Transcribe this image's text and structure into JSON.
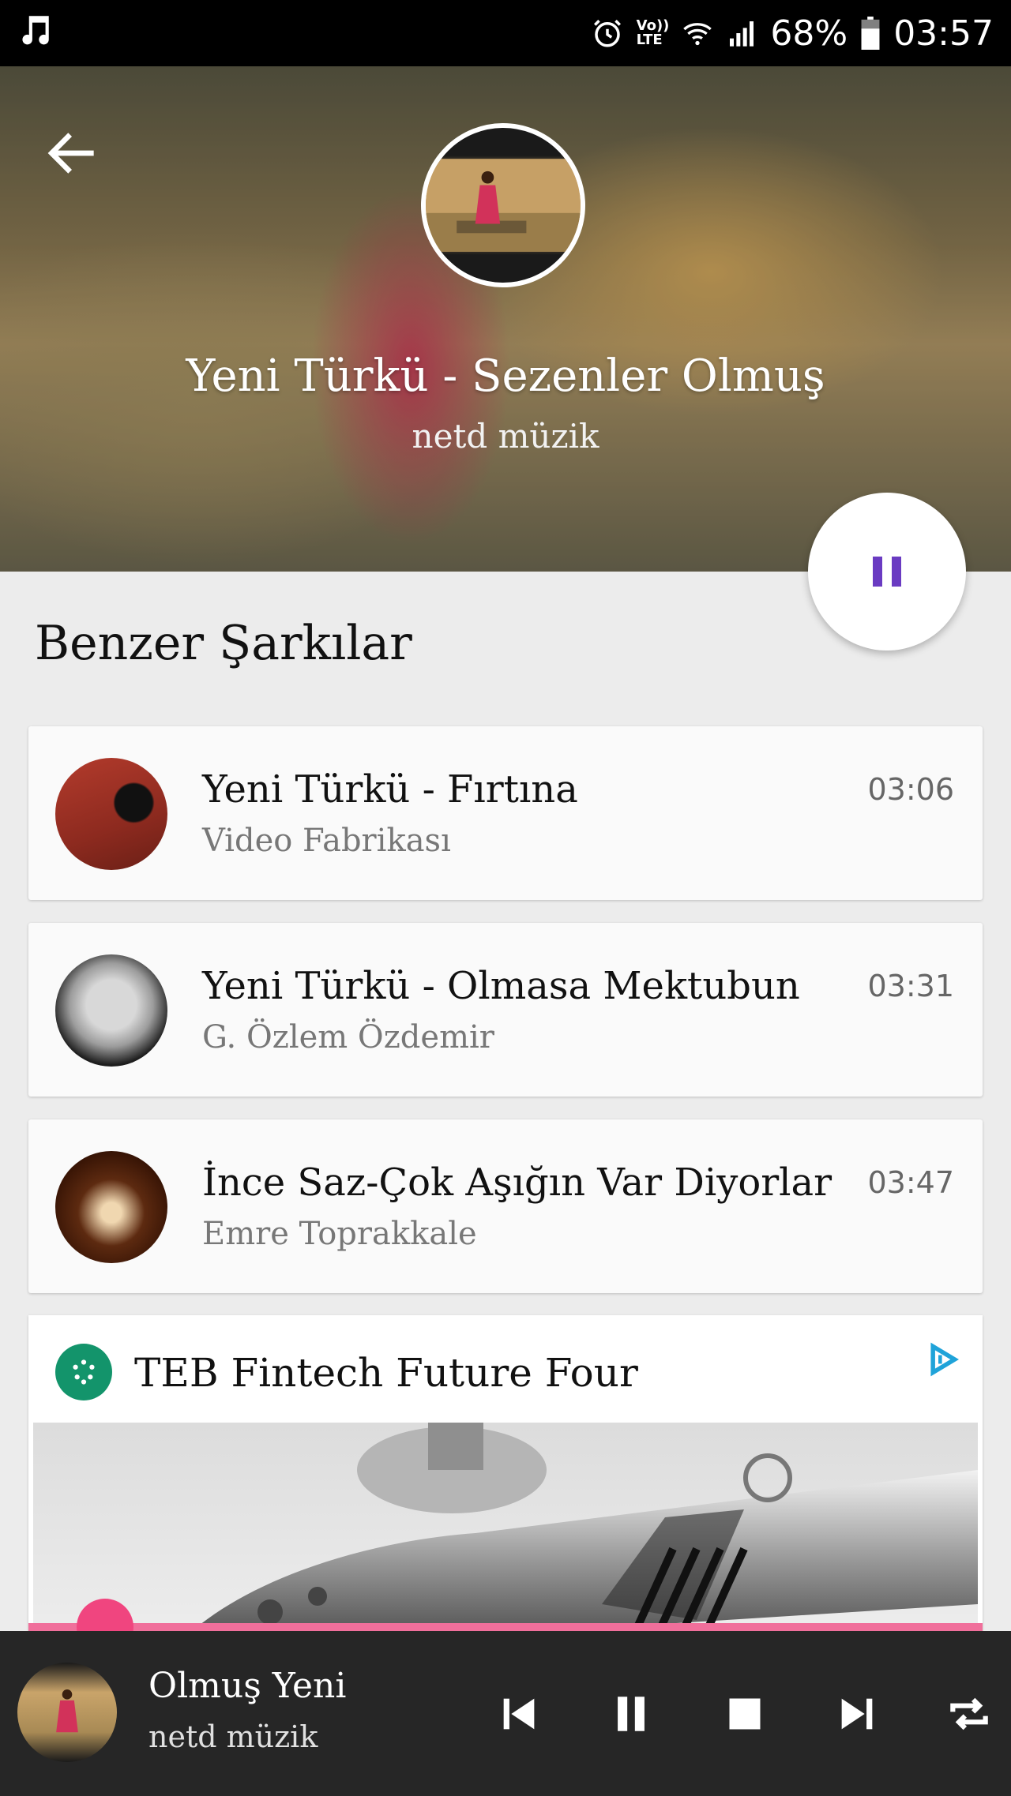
{
  "status_bar": {
    "battery": "68%",
    "time": "03:57",
    "network_top": "Vo))",
    "network_bottom": "LTE"
  },
  "now_playing": {
    "title": "Yeni Türkü - Sezenler Olmuş",
    "artist": "netd müzik"
  },
  "section": {
    "title": "Benzer Şarkılar"
  },
  "similar_songs": [
    {
      "title": "Yeni Türkü - Fırtına",
      "channel": "Video Fabrikası",
      "duration": "03:06"
    },
    {
      "title": "Yeni Türkü - Olmasa Mektubun",
      "channel": "G. Özlem Özdemir",
      "duration": "03:31"
    },
    {
      "title": "İnce Saz-Çok Aşığın Var Diyorlar",
      "channel": "Emre Toprakkale",
      "duration": "03:47"
    }
  ],
  "ad": {
    "title": "TEB Fintech Future Four"
  },
  "mini_player": {
    "title": "Olmuş      Yeni",
    "artist": "netd müzik",
    "progress": 0.08
  },
  "colors": {
    "accent_pause": "#6a3bc2",
    "progress": "#f06f9b",
    "progress_thumb": "#f0457f",
    "player_bg": "#262626"
  }
}
